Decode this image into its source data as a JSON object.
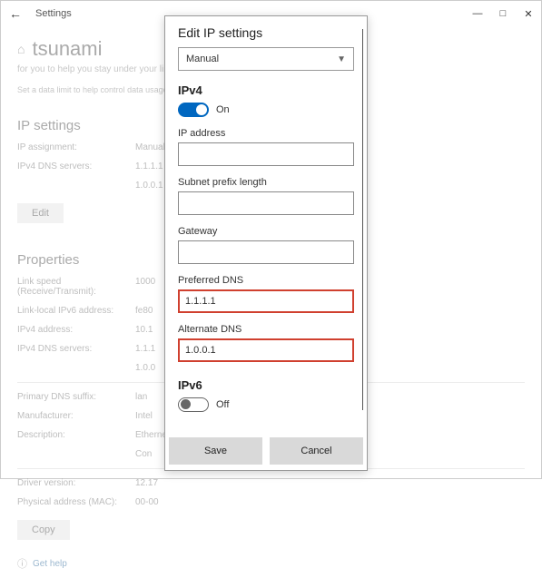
{
  "window": {
    "title": "Settings"
  },
  "bg": {
    "network_name": "tsunami",
    "subtitle": "for you to help you stay under your limit",
    "line2": "Set a data limit to help control data usage",
    "ip_settings_heading": "IP settings",
    "ip_assignment_label": "IP assignment:",
    "ip_assignment_value": "Manual",
    "ipv4_dns_label": "IPv4 DNS servers:",
    "ipv4_dns_value1": "1.1.1.1",
    "ipv4_dns_value2": "1.0.0.1",
    "edit_btn": "Edit",
    "properties_heading": "Properties",
    "rows": {
      "link_speed_k": "Link speed (Receive/Transmit):",
      "link_speed_v": "1000",
      "link_local_k": "Link-local IPv6 address:",
      "link_local_v": "fe80",
      "ipv4_addr_k": "IPv4 address:",
      "ipv4_addr_v": "10.1",
      "ipv4_dns_k": "IPv4 DNS servers:",
      "ipv4_dns_v": "1.1.1",
      "ipv4_dns_v2": "1.0.0",
      "primary_dns_k": "Primary DNS suffix:",
      "primary_dns_v": "lan",
      "manufacturer_k": "Manufacturer:",
      "manufacturer_v": "Intel",
      "description_k": "Description:",
      "description_v": "Ethernet",
      "description_v2": "Con",
      "driver_k": "Driver version:",
      "driver_v": "12.17",
      "mac_k": "Physical address (MAC):",
      "mac_v": "00-00"
    },
    "copy_btn": "Copy",
    "gethelp": "Get help"
  },
  "modal": {
    "title": "Edit IP settings",
    "mode_selected": "Manual",
    "ipv4_heading": "IPv4",
    "ipv4_on_label": "On",
    "ip_address_label": "IP address",
    "ip_address_value": "",
    "subnet_label": "Subnet prefix length",
    "subnet_value": "",
    "gateway_label": "Gateway",
    "gateway_value": "",
    "preferred_dns_label": "Preferred DNS",
    "preferred_dns_value": "1.1.1.1",
    "alternate_dns_label": "Alternate DNS",
    "alternate_dns_value": "1.0.0.1",
    "ipv6_heading": "IPv6",
    "ipv6_off_label": "Off",
    "save_label": "Save",
    "cancel_label": "Cancel"
  }
}
